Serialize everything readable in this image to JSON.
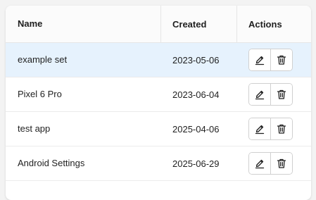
{
  "table": {
    "columns": {
      "name": "Name",
      "created": "Created",
      "actions": "Actions"
    },
    "rows": [
      {
        "name": "example set",
        "created": "2023-05-06",
        "selected": true
      },
      {
        "name": "Pixel 6 Pro",
        "created": "2023-06-04",
        "selected": false
      },
      {
        "name": "test app",
        "created": "2025-04-06",
        "selected": false
      },
      {
        "name": "Android Settings",
        "created": "2025-06-29",
        "selected": false
      }
    ],
    "row_actions": [
      "edit-icon",
      "delete-icon"
    ]
  },
  "colors": {
    "selected_row": "#e6f2fd",
    "text": "#1f1f1f",
    "border": "#d0d0d0"
  }
}
